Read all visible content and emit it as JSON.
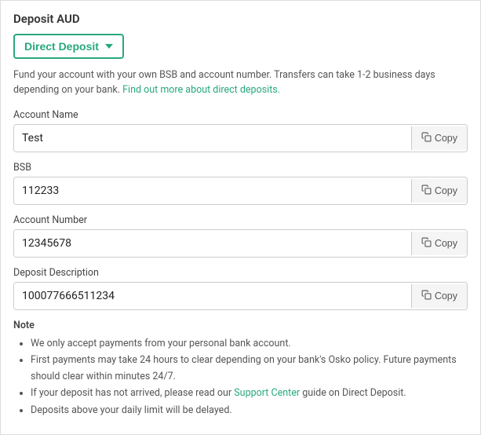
{
  "page": {
    "title": "Deposit AUD",
    "dropdown_label": "Direct Deposit",
    "description": "Fund your account with your own BSB and account number. Transfers can take 1-2 business days depending on your bank.",
    "description_link_text": "Find out more about direct deposits.",
    "description_link_href": "#"
  },
  "fields": [
    {
      "label": "Account Name",
      "value": "Test",
      "copy_label": "Copy"
    },
    {
      "label": "BSB",
      "value": "112233",
      "copy_label": "Copy"
    },
    {
      "label": "Account Number",
      "value": "12345678",
      "copy_label": "Copy"
    },
    {
      "label": "Deposit Description",
      "value": "100077666511234",
      "copy_label": "Copy"
    }
  ],
  "note": {
    "label": "Note",
    "items": [
      "We only accept payments from your personal bank account.",
      "First payments may take 24 hours to clear depending on your bank's Osko policy. Future payments should clear within minutes 24/7.",
      "If your deposit has not arrived, please read our {Support Center} guide on Direct Deposit.",
      "Deposits above your daily limit will be delayed."
    ],
    "support_center_text": "Support Center",
    "support_center_href": "#"
  },
  "colors": {
    "accent": "#27a97a"
  }
}
